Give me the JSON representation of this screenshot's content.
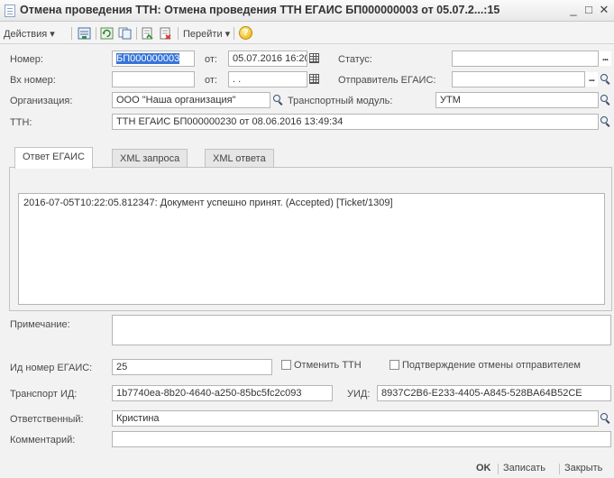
{
  "window": {
    "title": "Отмена проведения ТТН: Отмена проведения ТТН ЕГАИС БП000000003 от 05.07.2...:15",
    "minimize": "_",
    "maximize": "□",
    "close": "✕"
  },
  "toolbar": {
    "actions_label": "Действия",
    "goto_label": "Перейти",
    "help_label": "?"
  },
  "form": {
    "number_label": "Номер:",
    "number_value": "БП000000003",
    "from_label": "от:",
    "date_value": "05.07.2016 16:20",
    "status_label": "Статус:",
    "status_value": "",
    "incoming_number_label": "Вх номер:",
    "incoming_number_value": "",
    "incoming_from_label": "от:",
    "incoming_date_value": ". .",
    "sender_label": "Отправитель ЕГАИС:",
    "sender_value": "",
    "org_label": "Организация:",
    "org_value": "ООО \"Наша организация\"",
    "transport_module_label": "Транспортный модуль:",
    "transport_module_value": "УТМ",
    "ttn_label": "ТТН:",
    "ttn_value": "ТТН ЕГАИС БП000000230 от 08.06.2016 13:49:34"
  },
  "tabs": [
    {
      "label": "Ответ ЕГАИС"
    },
    {
      "label": "XML запроса"
    },
    {
      "label": "XML ответа"
    }
  ],
  "response_text": "2016-07-05T10:22:05.812347: Документ успешно принят. (Accepted) [Ticket/1309]",
  "lower": {
    "note_label": "Примечание:",
    "note_value": "",
    "egais_id_label": "Ид номер ЕГАИС:",
    "egais_id_value": "25",
    "cancel_ttn_label": "Отменить ТТН",
    "sender_confirm_label": "Подтверждение отмены отправителем",
    "transport_id_label": "Транспорт ИД:",
    "transport_id_value": "1b7740ea-8b20-4640-a250-85bc5fc2c093",
    "uid_label": "УИД:",
    "uid_value": "8937C2B6-E233-4405-A845-528BA64B52CE",
    "responsible_label": "Ответственный:",
    "responsible_value": "Кристина",
    "comment_label": "Комментарий:",
    "comment_value": ""
  },
  "footer": {
    "ok_label": "OK",
    "save_label": "Записать",
    "close_label": "Закрыть"
  },
  "icons": [
    "document-icon",
    "list-icon",
    "refresh-icon",
    "copy-icon",
    "post-icon",
    "unpost-icon",
    "help-icon",
    "search-icon",
    "calendar-icon"
  ]
}
